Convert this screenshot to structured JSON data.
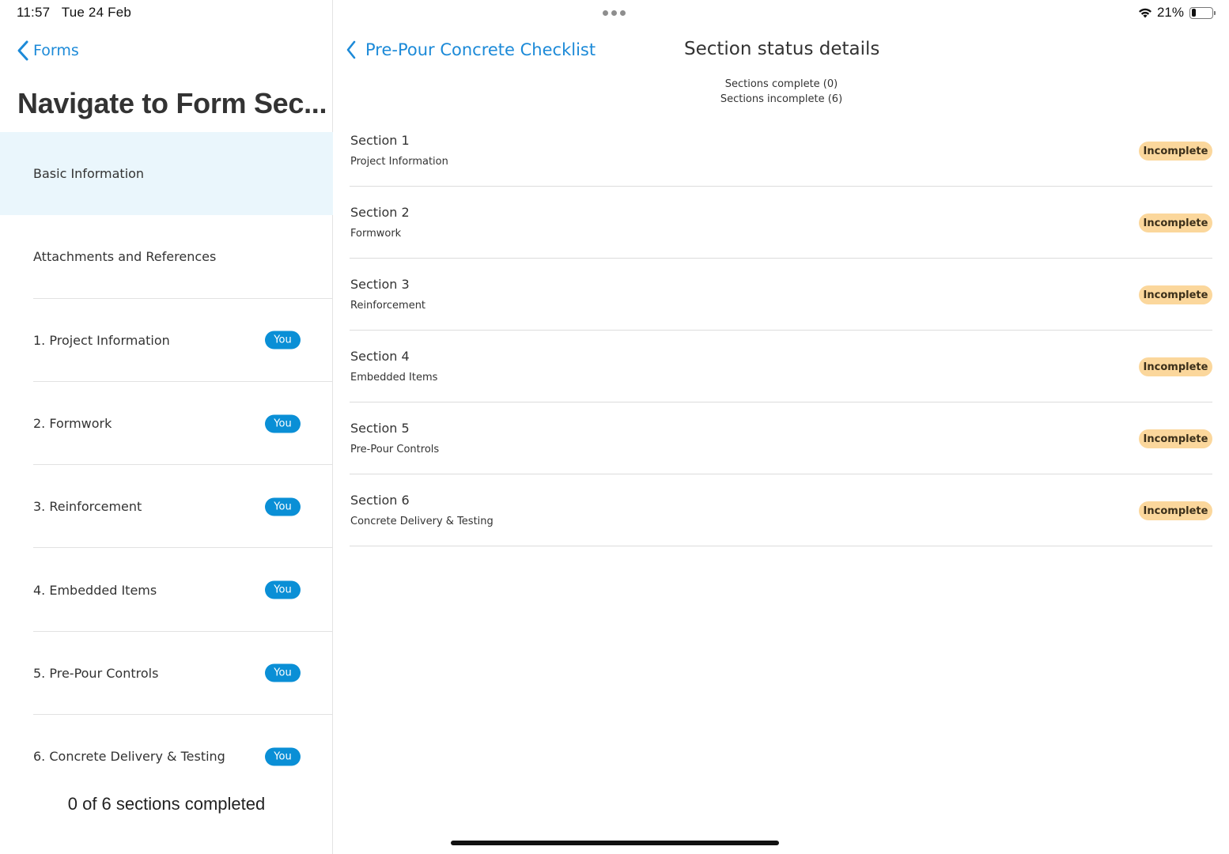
{
  "status_bar": {
    "time": "11:57",
    "date": "Tue 24 Feb",
    "battery_percent": "21%",
    "battery_level": 0.21
  },
  "left_pane": {
    "back_label": "Forms",
    "title": "Navigate to Form Sec...",
    "items": [
      {
        "label": "Basic Information",
        "badge": ""
      },
      {
        "label": "Attachments and References",
        "badge": ""
      },
      {
        "label": "1. Project Information",
        "badge": "You"
      },
      {
        "label": "2. Formwork",
        "badge": "You"
      },
      {
        "label": "3. Reinforcement",
        "badge": "You"
      },
      {
        "label": "4. Embedded Items",
        "badge": "You"
      },
      {
        "label": "5. Pre-Pour Controls",
        "badge": "You"
      },
      {
        "label": "6. Concrete Delivery & Testing",
        "badge": "You"
      }
    ],
    "progress_text": "0 of 6 sections completed"
  },
  "right_pane": {
    "back_label": "Pre-Pour Concrete Checklist",
    "title": "Section status details",
    "summary_complete": "Sections complete (0)",
    "summary_incomplete": "Sections incomplete (6)",
    "sections": [
      {
        "title": "Section 1",
        "subtitle": "Project Information",
        "status": "Incomplete"
      },
      {
        "title": "Section 2",
        "subtitle": "Formwork",
        "status": "Incomplete"
      },
      {
        "title": "Section 3",
        "subtitle": "Reinforcement",
        "status": "Incomplete"
      },
      {
        "title": "Section 4",
        "subtitle": "Embedded Items",
        "status": "Incomplete"
      },
      {
        "title": "Section 5",
        "subtitle": "Pre-Pour Controls",
        "status": "Incomplete"
      },
      {
        "title": "Section 6",
        "subtitle": "Concrete Delivery & Testing",
        "status": "Incomplete"
      }
    ]
  },
  "colors": {
    "accent": "#1c8ad8",
    "you_badge": "#0a8fd6",
    "incomplete_badge": "#fbd79c",
    "active_row": "#eaf6fc"
  },
  "icons": {
    "back": "chevron-left-icon",
    "wifi": "wifi-icon",
    "battery": "battery-icon",
    "multitask": "more-dots-icon"
  }
}
